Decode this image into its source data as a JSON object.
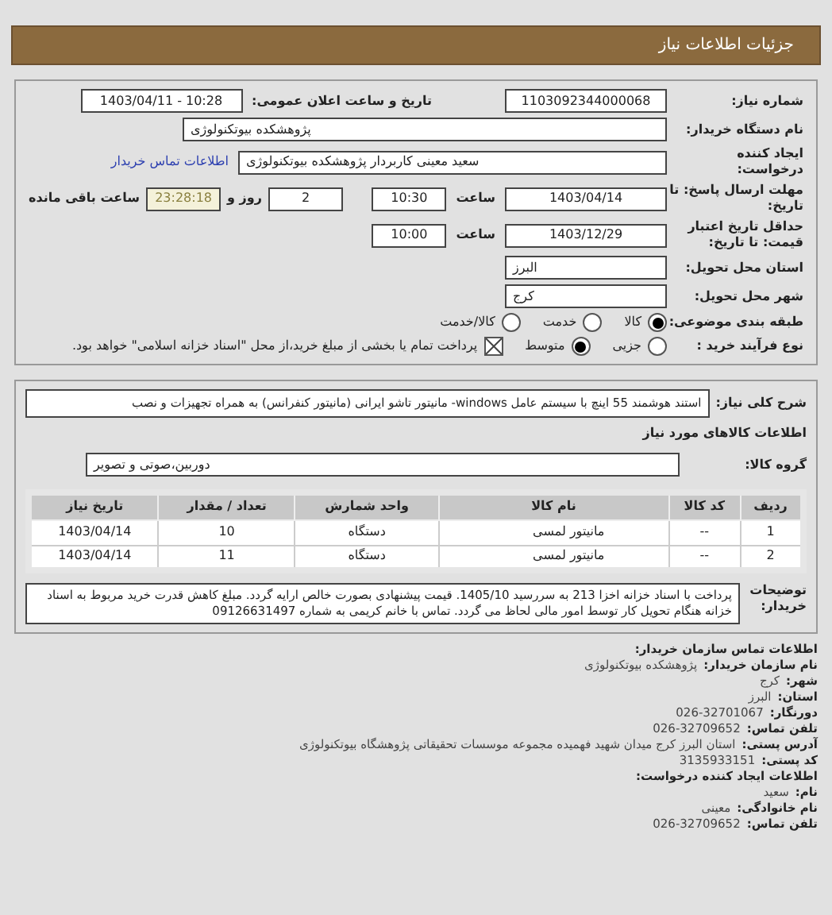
{
  "header": {
    "title": "جزئیات اطلاعات نیاز"
  },
  "need_number": {
    "label": "شماره نیاز:",
    "value": "1103092344000068"
  },
  "announce": {
    "label": "تاریخ و ساعت اعلان عمومی:",
    "value": "1403/04/11 - 10:28"
  },
  "buyer": {
    "label": "نام دستگاه خریدار:",
    "value": "پژوهشکده بیوتکنولوژی"
  },
  "creator": {
    "label": "ایجاد کننده درخواست:",
    "value": "سعید معینی کاربردار پژوهشکده بیوتکنولوژی",
    "link": "اطلاعات تماس خریدار"
  },
  "deadline": {
    "label": "مهلت ارسال پاسخ: تا تاریخ:",
    "date": "1403/04/14",
    "time_label": "ساعت",
    "time": "10:30",
    "days": "2",
    "days_label": "روز و",
    "remaining": "23:28:18",
    "remaining_label": "ساعت باقی مانده"
  },
  "validity": {
    "label": "حداقل تاریخ اعتبار قیمت: تا تاریخ:",
    "date": "1403/12/29",
    "time_label": "ساعت",
    "time": "10:00"
  },
  "province": {
    "label": "استان محل تحویل:",
    "value": "البرز"
  },
  "city": {
    "label": "شهر محل تحویل:",
    "value": "کرج"
  },
  "category": {
    "label": "طبقه بندی موضوعی:",
    "options": [
      {
        "label": "کالا",
        "selected": true
      },
      {
        "label": "خدمت",
        "selected": false
      },
      {
        "label": "کالا/خدمت",
        "selected": false
      }
    ]
  },
  "process": {
    "label": "نوع فرآیند خرید :",
    "options": [
      {
        "label": "جزیی",
        "selected": false
      },
      {
        "label": "متوسط",
        "selected": true
      }
    ],
    "treasury": {
      "checked": true,
      "text": "پرداخت تمام یا بخشی از مبلغ خرید،از محل \"اسناد خزانه اسلامی\" خواهد بود."
    }
  },
  "summary": {
    "label": "شرح کلی نیاز:",
    "value": "استند هوشمند 55 اینچ با سیستم عامل windows- مانیتور تاشو ایرانی (مانیتور کنفرانس) به همراه تجهیزات و نصب"
  },
  "goods_title": "اطلاعات کالاهای مورد نیاز",
  "group": {
    "label": "گروه کالا:",
    "value": "دوربین،صوتی و تصویر"
  },
  "table": {
    "columns": [
      "ردیف",
      "کد کالا",
      "نام کالا",
      "واحد شمارش",
      "تعداد / مقدار",
      "تاریخ نیاز"
    ],
    "rows": [
      [
        "1",
        "--",
        "مانیتور لمسی",
        "دستگاه",
        "10",
        "1403/04/14"
      ],
      [
        "2",
        "--",
        "مانیتور لمسی",
        "دستگاه",
        "11",
        "1403/04/14"
      ]
    ]
  },
  "notes": {
    "label": "توضیحات خریدار:",
    "text": "پرداخت با اسناد خزانه اخزا 213 به سررسید 1405/10. قیمت پیشنهادی بصورت خالص ارایه گردد. مبلغ کاهش قدرت خرید مربوط به اسناد خزانه هنگام تحویل کار توسط امور مالی لحاظ می گردد. تماس با خانم کریمی به شماره 09126631497"
  },
  "contact": {
    "title": "اطلاعات تماس سازمان خریدار:",
    "lines": [
      {
        "label": "نام سازمان خریدار:",
        "value": "پژوهشکده بیوتکنولوژی"
      },
      {
        "label": "شهر:",
        "value": "کرج"
      },
      {
        "label": "استان:",
        "value": "البرز"
      },
      {
        "label": "دورنگار:",
        "value": "026-32701067"
      },
      {
        "label": "تلفن تماس:",
        "value": "026-32709652"
      },
      {
        "label": "آدرس پستی:",
        "value": "استان البرز کرج میدان شهید فهمیده مجموعه موسسات تحقیقاتی پژوهشگاه بیوتکنولوژی"
      },
      {
        "label": "کد پستی:",
        "value": "3135933151"
      }
    ]
  },
  "creator_info": {
    "title": "اطلاعات ایجاد کننده درخواست:",
    "lines": [
      {
        "label": "نام:",
        "value": "سعید"
      },
      {
        "label": "نام خانوادگی:",
        "value": "معینی"
      },
      {
        "label": "تلفن تماس:",
        "value": "026-32709652"
      }
    ]
  }
}
